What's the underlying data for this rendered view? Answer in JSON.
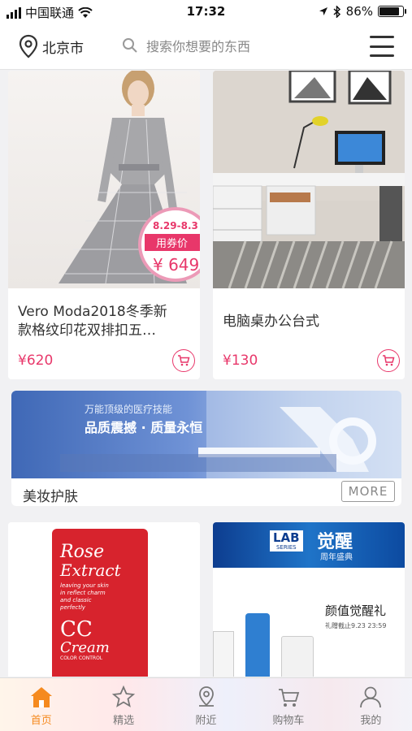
{
  "status_bar": {
    "carrier": "中国联通",
    "time": "17:32",
    "battery": "86%",
    "battery_level": 0.86
  },
  "header": {
    "location": "北京市",
    "search_placeholder": "搜索你想要的东西"
  },
  "products_row1": [
    {
      "title_line1": "Vero Moda2018冬季新",
      "title_line2": "款格纹印花双排扣五…",
      "price": "¥620",
      "badge_date": "8.29-8.3",
      "badge_label": "用券价",
      "badge_price": "¥ 649"
    },
    {
      "title_line1": "电脑桌办公台式",
      "title_line2": "",
      "price": "¥130"
    }
  ],
  "banner": {
    "headline_small": "万能顶级的医疗技能",
    "headline_big": "品质震撼 · 质量永恒",
    "title": "美妆护肤",
    "more_label": "MORE"
  },
  "products_row2": [
    {
      "brand_line1": "Rose",
      "brand_line2": "Extract",
      "desc": "leaving your skin in reflect charm and classic perfectly",
      "cc_line1": "CC",
      "cc_line2": "Cream",
      "cc_sub": "COLOR CONTROL"
    },
    {
      "logo_line1": "LAB",
      "logo_line2": "SERIES",
      "promo_title": "觉醒",
      "promo_sub": "周年盛典",
      "ad_title": "颜值觉醒礼",
      "ad_sub": "礼赠截止9.23 23:59"
    }
  ],
  "tabs": [
    {
      "label": "首页",
      "icon": "home-icon",
      "active": true
    },
    {
      "label": "精选",
      "icon": "star-icon",
      "active": false
    },
    {
      "label": "附近",
      "icon": "location-icon",
      "active": false
    },
    {
      "label": "购物车",
      "icon": "cart-icon",
      "active": false
    },
    {
      "label": "我的",
      "icon": "user-icon",
      "active": false
    }
  ],
  "colors": {
    "accent": "#e8376a",
    "tab_active": "#f58a1f"
  }
}
